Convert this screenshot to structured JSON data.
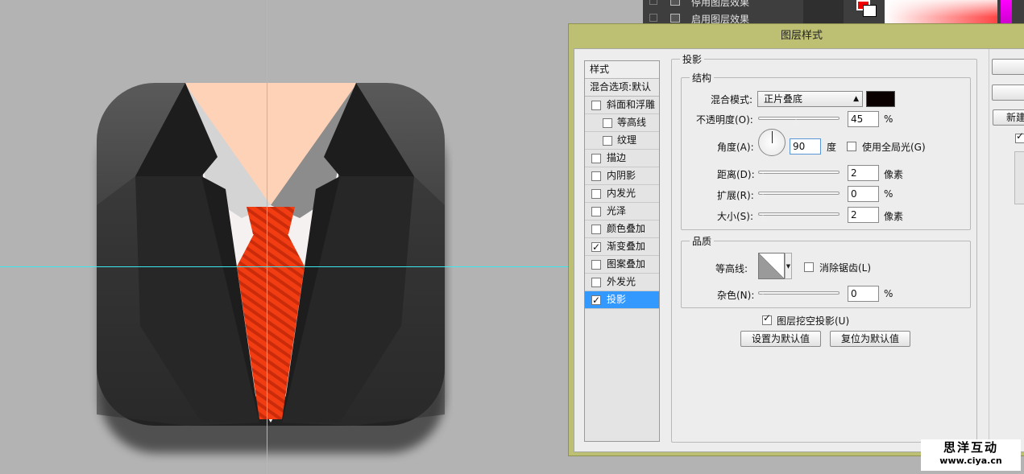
{
  "ps_panel": {
    "rows": [
      "停用图层效果",
      "启用图层效果"
    ],
    "foreground_color": "#ee0000",
    "background_color": "#ffffff"
  },
  "dialog": {
    "title": "图层样式",
    "style_list": {
      "header": "样式",
      "blend_options": "混合选项:默认",
      "items": [
        {
          "label": "斜面和浮雕",
          "checked": false,
          "sub": false,
          "active": false
        },
        {
          "label": "等高线",
          "checked": false,
          "sub": true,
          "active": false
        },
        {
          "label": "纹理",
          "checked": false,
          "sub": true,
          "active": false
        },
        {
          "label": "描边",
          "checked": false,
          "sub": false,
          "active": false
        },
        {
          "label": "内阴影",
          "checked": false,
          "sub": false,
          "active": false
        },
        {
          "label": "内发光",
          "checked": false,
          "sub": false,
          "active": false
        },
        {
          "label": "光泽",
          "checked": false,
          "sub": false,
          "active": false
        },
        {
          "label": "颜色叠加",
          "checked": false,
          "sub": false,
          "active": false
        },
        {
          "label": "渐变叠加",
          "checked": true,
          "sub": false,
          "active": false
        },
        {
          "label": "图案叠加",
          "checked": false,
          "sub": false,
          "active": false
        },
        {
          "label": "外发光",
          "checked": false,
          "sub": false,
          "active": false
        },
        {
          "label": "投影",
          "checked": true,
          "sub": false,
          "active": true
        }
      ]
    },
    "drop_shadow": {
      "section_title": "投影",
      "structure_title": "结构",
      "blend_mode_label": "混合模式:",
      "blend_mode_value": "正片叠底",
      "shadow_color": "#0a0000",
      "opacity_label": "不透明度(O):",
      "opacity_value": "45",
      "opacity_unit": "%",
      "opacity": 45,
      "angle_label": "角度(A):",
      "angle_value": "90",
      "angle_unit": "度",
      "global_light_label": "使用全局光(G)",
      "global_light": false,
      "distance_label": "距离(D):",
      "distance_value": "2",
      "distance_unit": "像素",
      "spread_label": "扩展(R):",
      "spread_value": "0",
      "spread_unit": "%",
      "size_label": "大小(S):",
      "size_value": "2",
      "size_unit": "像素",
      "quality_title": "品质",
      "contour_label": "等高线:",
      "antialias_label": "消除锯齿(L)",
      "antialias": false,
      "noise_label": "杂色(N):",
      "noise_value": "0",
      "noise_unit": "%",
      "knockout_label": "图层挖空投影(U)",
      "knockout": true,
      "make_default": "设置为默认值",
      "reset_default": "复位为默认值"
    },
    "right_buttons": {
      "new_style_partial": "新建",
      "preview_checked": true
    }
  },
  "icon": {
    "colors": {
      "suit": "#2b2b2b",
      "lapel": "#1c1c1c",
      "skin": "#fdd2b7",
      "shirt": "#f6f1f1",
      "collar_light": "#d5d5d5",
      "collar_dark": "#8c8c8c",
      "tie": "#f03a12",
      "tie_stripe": "#c92a0a"
    }
  },
  "watermark": {
    "name": "思洋互动",
    "url": "www.ciya.cn"
  }
}
